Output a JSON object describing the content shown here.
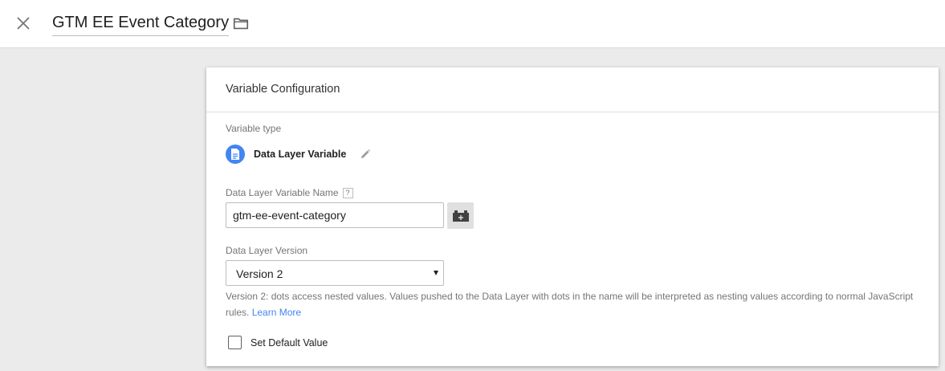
{
  "header": {
    "title": "GTM EE Event Category",
    "close_icon": "close-icon",
    "folder_icon": "folder-icon"
  },
  "card": {
    "title": "Variable Configuration",
    "variable_type_label": "Variable type",
    "variable_type_name": "Data Layer Variable",
    "variable_type_icon": "document-icon",
    "variable_type_icon_color": "#4285f4",
    "edit_icon": "pencil-icon",
    "name_label": "Data Layer Variable Name",
    "help_glyph": "?",
    "name_value": "gtm-ee-event-category",
    "variable_picker_icon": "lego-brick-icon",
    "version_label": "Data Layer Version",
    "version_selected": "Version 2",
    "version_help": "Version 2: dots access nested values. Values pushed to the Data Layer with dots in the name will be interpreted as nesting values according to normal JavaScript rules.",
    "learn_more": "Learn More",
    "link_color": "#4285f4",
    "default_value_label": "Set Default Value",
    "default_value_checked": false
  }
}
